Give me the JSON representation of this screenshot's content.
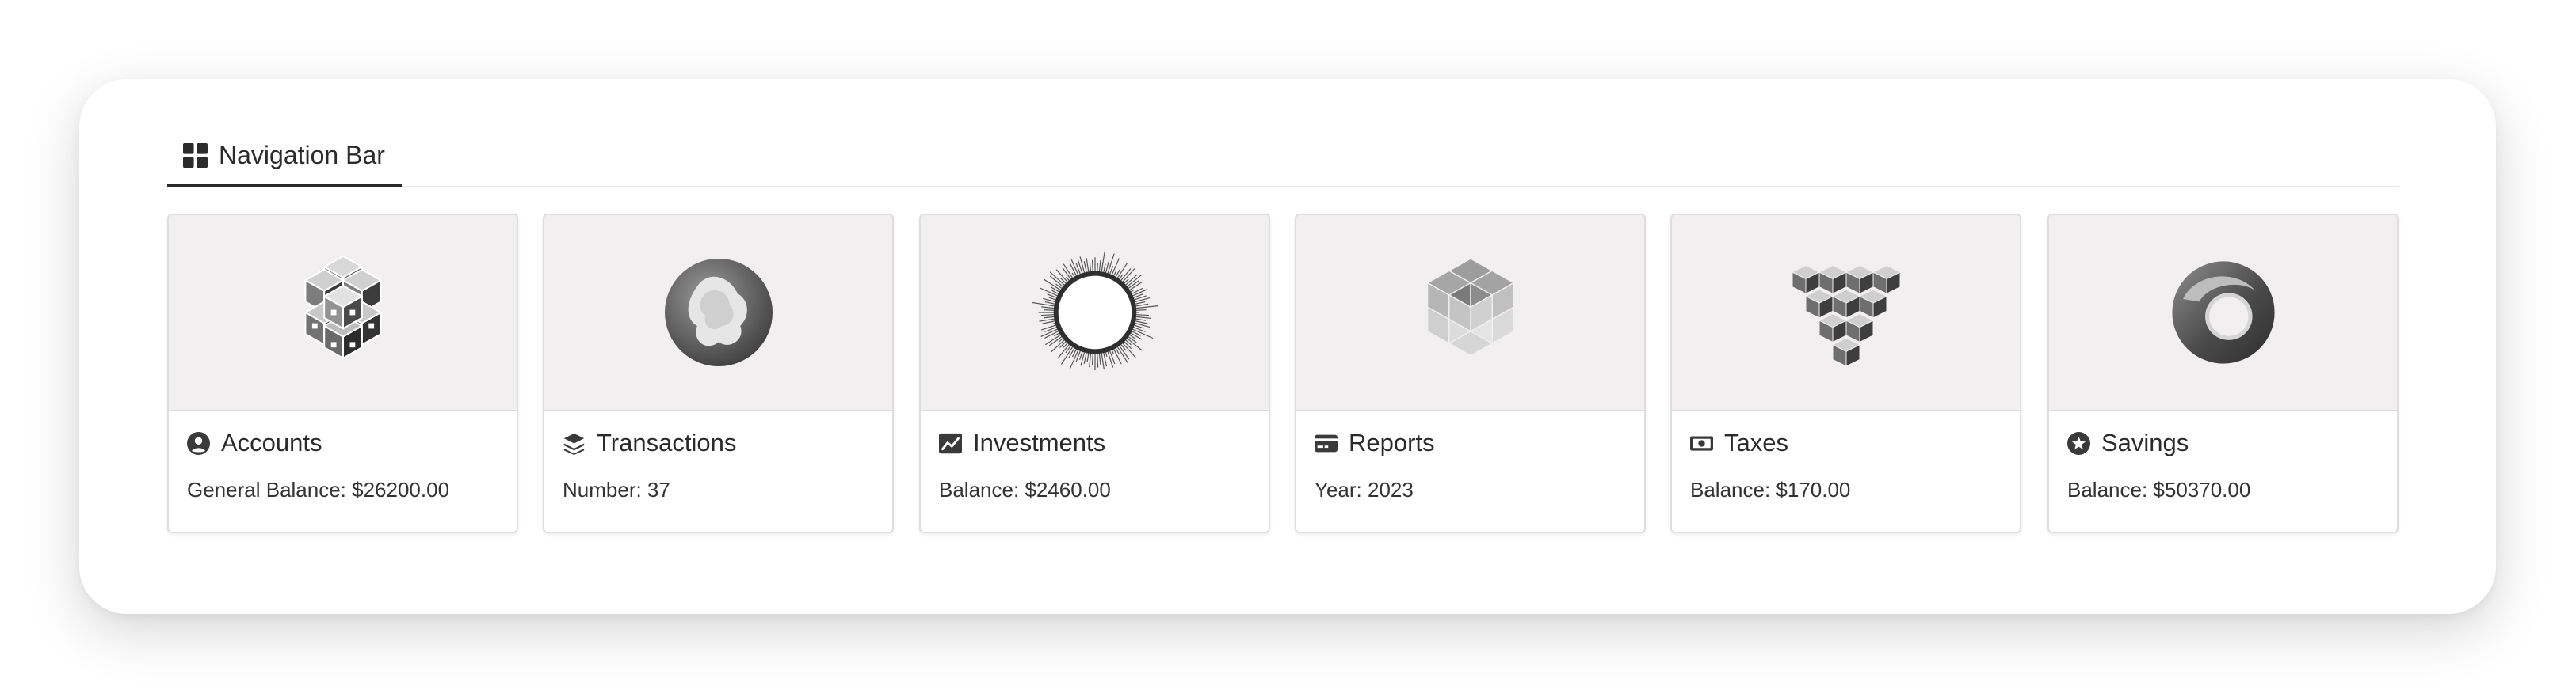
{
  "colors": {
    "background": "#ffffff",
    "panel": "#ffffff",
    "media_background": "#f1eff0",
    "border": "#dedede",
    "tab_underline": "#2b2b2b",
    "text": "#2a2a2a"
  },
  "tabs": [
    {
      "label": "Navigation Bar",
      "icon": "grid-icon",
      "active": true
    }
  ],
  "cards": [
    {
      "title": "Accounts",
      "icon": "user-circle-icon",
      "image": "cube-cluster-illustration",
      "detail": "General Balance: $26200.00"
    },
    {
      "title": "Transactions",
      "icon": "layers-icon",
      "image": "blob-sphere-illustration",
      "detail": "Number: 37"
    },
    {
      "title": "Investments",
      "icon": "chart-line-icon",
      "image": "sunburst-ring-illustration",
      "detail": "Balance: $2460.00"
    },
    {
      "title": "Reports",
      "icon": "credit-card-icon",
      "image": "hex-cubes-illustration",
      "detail": "Year: 2023"
    },
    {
      "title": "Taxes",
      "icon": "money-bill-icon",
      "image": "cube-pyramid-illustration",
      "detail": "Balance: $170.00"
    },
    {
      "title": "Savings",
      "icon": "star-circle-icon",
      "image": "torus-ring-illustration",
      "detail": "Balance: $50370.00"
    }
  ]
}
